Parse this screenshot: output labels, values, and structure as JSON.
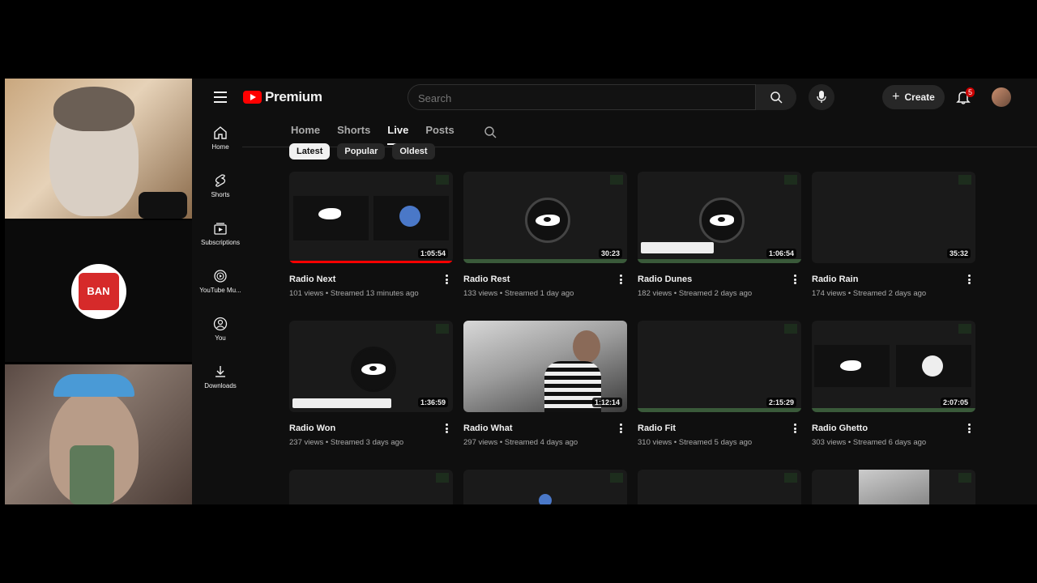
{
  "app": {
    "brand": "Premium"
  },
  "search": {
    "placeholder": "Search"
  },
  "header": {
    "create_label": "Create",
    "notification_count": "5"
  },
  "sidebar": {
    "items": [
      {
        "label": "Home",
        "icon": "home-icon"
      },
      {
        "label": "Shorts",
        "icon": "shorts-icon"
      },
      {
        "label": "Subscriptions",
        "icon": "subscriptions-icon"
      },
      {
        "label": "YouTube Mu...",
        "icon": "youtube-music-icon"
      },
      {
        "label": "You",
        "icon": "you-icon"
      },
      {
        "label": "Downloads",
        "icon": "download-icon"
      }
    ]
  },
  "tabs": [
    {
      "label": "Home"
    },
    {
      "label": "Shorts"
    },
    {
      "label": "Live"
    },
    {
      "label": "Posts"
    }
  ],
  "chips": [
    {
      "label": "Latest"
    },
    {
      "label": "Popular"
    },
    {
      "label": "Oldest"
    }
  ],
  "videos": [
    {
      "title": "Radio Next",
      "views": "101 views",
      "streamed": "Streamed 13 minutes ago",
      "duration": "1:05:54"
    },
    {
      "title": "Radio Rest",
      "views": "133 views",
      "streamed": "Streamed 1 day ago",
      "duration": "30:23"
    },
    {
      "title": "Radio Dunes",
      "views": "182 views",
      "streamed": "Streamed 2 days ago",
      "duration": "1:06:54"
    },
    {
      "title": "Radio Rain",
      "views": "174 views",
      "streamed": "Streamed 2 days ago",
      "duration": "35:32"
    },
    {
      "title": "Radio Won",
      "views": "237 views",
      "streamed": "Streamed 3 days ago",
      "duration": "1:36:59"
    },
    {
      "title": "Radio What",
      "views": "297 views",
      "streamed": "Streamed 4 days ago",
      "duration": "1:12:14"
    },
    {
      "title": "Radio Fit",
      "views": "310 views",
      "streamed": "Streamed 5 days ago",
      "duration": "2:15:29"
    },
    {
      "title": "Radio Ghetto",
      "views": "303 views",
      "streamed": "Streamed 6 days ago",
      "duration": "2:07:05"
    }
  ],
  "colors": {
    "accent": "#ff0000",
    "background": "#0f0f0f",
    "chip_active": "#f1f1f1"
  },
  "overlay": {
    "logo_text": "BAN"
  }
}
